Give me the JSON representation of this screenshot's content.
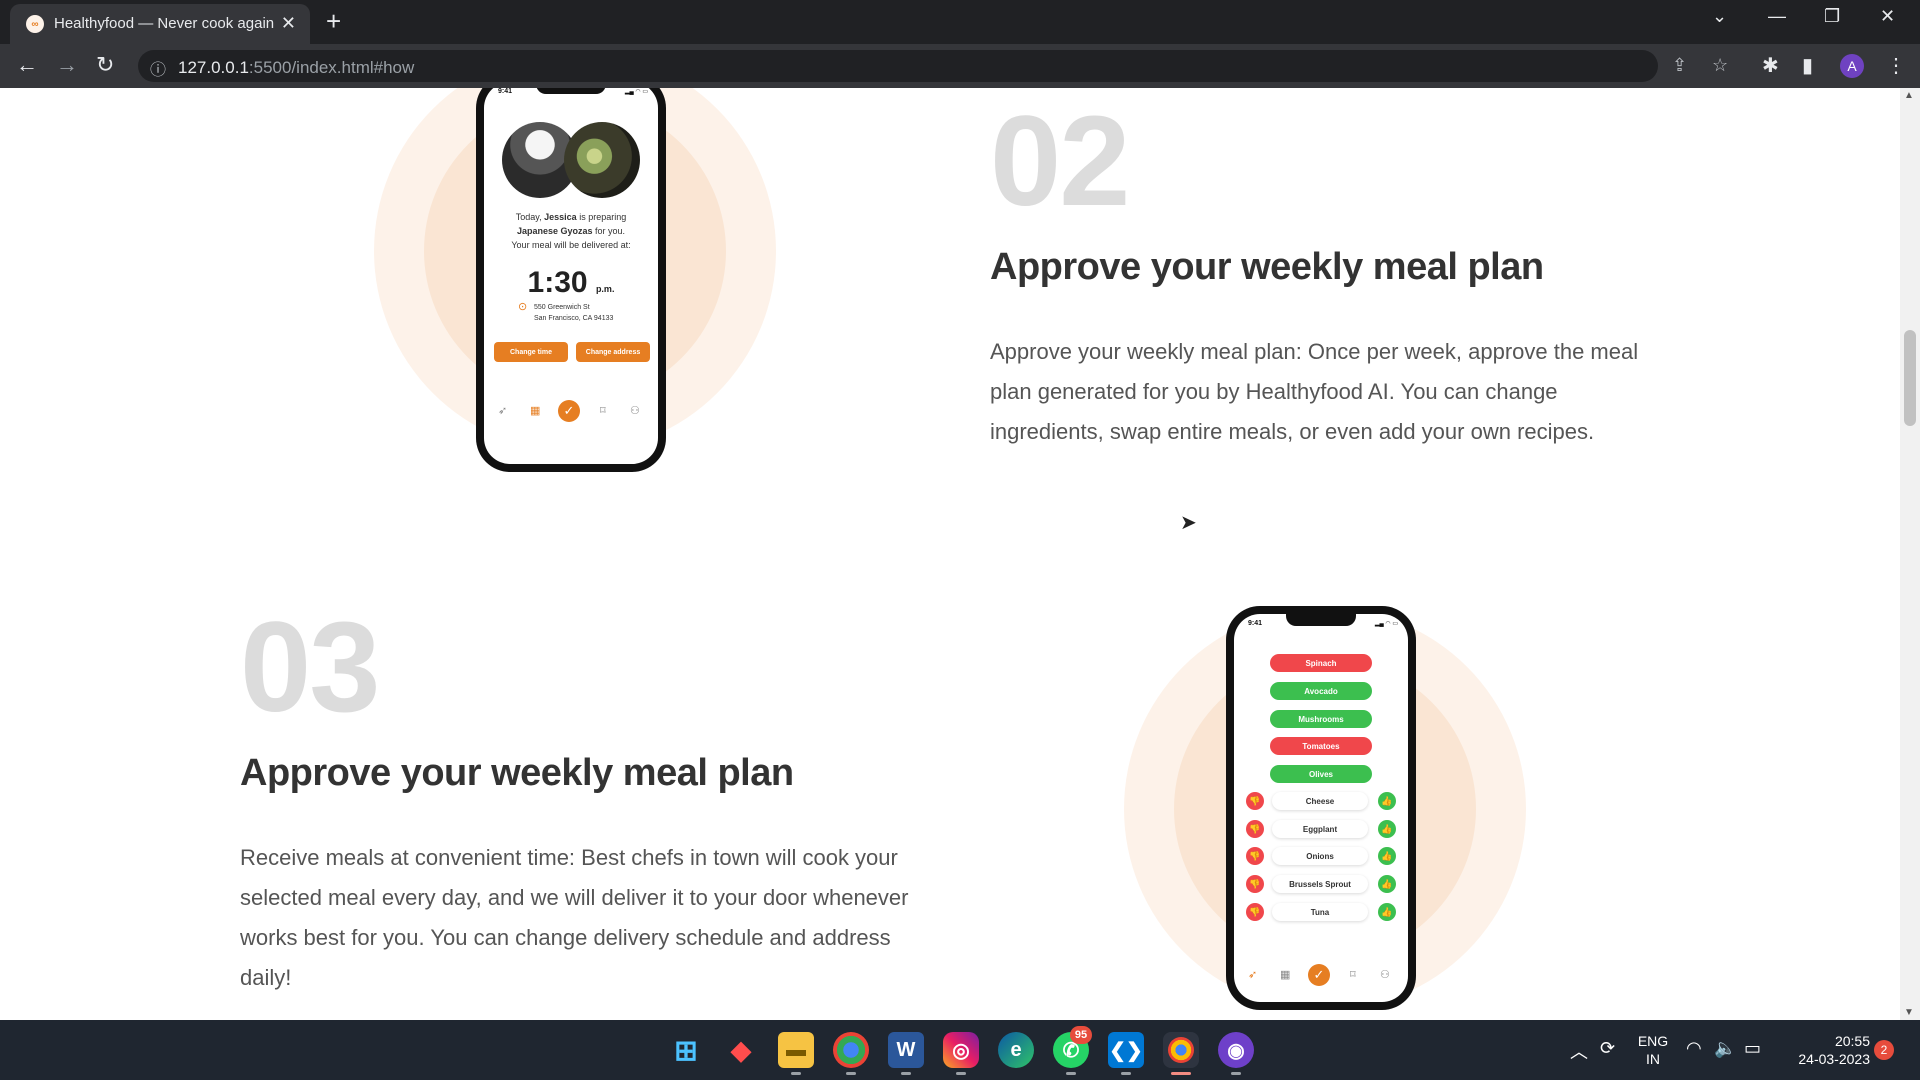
{
  "browser": {
    "tab_title": "Healthyfood — Never cook again",
    "favicon_text": "∞",
    "url_host": "127.0.0.1",
    "url_rest": ":5500/index.html#how",
    "profile_initial": "A"
  },
  "step2": {
    "number": "02",
    "title": "Approve your weekly meal plan",
    "description": "Approve your weekly meal plan: Once per week, approve the meal plan generated for you by Healthyfood AI. You can change ingredients, swap entire meals, or even add your own recipes.",
    "phone": {
      "status_time": "9:41",
      "line1_pre": "Today, ",
      "line1_name": "Jessica",
      "line1_post": " is preparing",
      "line2_dish": "Japanese Gyozas",
      "line2_post": " for you.",
      "line3": "Your meal will be delivered at:",
      "time": "1:30",
      "time_suffix": "p.m.",
      "address_line1": "550 Greenwich St",
      "address_line2": "San Francisco, CA 94133",
      "btn_change_time": "Change time",
      "btn_change_address": "Change address"
    }
  },
  "step3": {
    "number": "03",
    "title": "Approve your weekly meal plan",
    "description": "Receive meals at convenient time: Best chefs in town will cook your selected meal every day, and we will deliver it to your door whenever works best for you. You can change delivery schedule and address daily!",
    "phone": {
      "status_time": "9:41",
      "pills": [
        {
          "label": "Spinach",
          "color": "red"
        },
        {
          "label": "Avocado",
          "color": "green"
        },
        {
          "label": "Mushrooms",
          "color": "green"
        },
        {
          "label": "Tomatoes",
          "color": "red"
        },
        {
          "label": "Olives",
          "color": "green"
        }
      ],
      "rows": [
        "Cheese",
        "Eggplant",
        "Onions",
        "Brussels Sprout",
        "Tuna"
      ]
    }
  },
  "colors": {
    "accent": "#e67e22",
    "halo_outer": "#fdf2e9",
    "halo_inner": "#fae5d3",
    "pill_red": "#f0474b",
    "pill_green": "#3cbf4f"
  },
  "taskbar": {
    "whatsapp_badge": "95",
    "lang_line1": "ENG",
    "lang_line2": "IN",
    "clock_time": "20:55",
    "clock_date": "24-03-2023",
    "notification_count": "2"
  }
}
